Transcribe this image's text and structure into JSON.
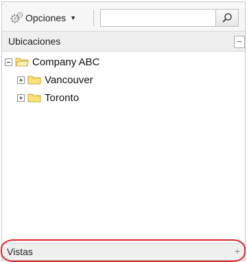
{
  "toolbar": {
    "options_label": "Opciones",
    "options_icon": "gear-icon",
    "search": {
      "value": "",
      "placeholder": ""
    },
    "search_icon": "magnifier-icon"
  },
  "locations_panel": {
    "title": "Ubicaciones",
    "collapse_glyph": "−",
    "tree": {
      "root": {
        "label": "Company ABC",
        "expanded": true
      },
      "children": [
        {
          "label": "Vancouver",
          "expanded": false
        },
        {
          "label": "Toronto",
          "expanded": false
        }
      ]
    }
  },
  "views_panel": {
    "title": "Vistas",
    "expand_glyph": "+",
    "highlight_color": "#e0242c"
  },
  "colors": {
    "folder_fill": "#ffe27a",
    "folder_stroke": "#c9a23a",
    "header_bg": "#efefef"
  }
}
